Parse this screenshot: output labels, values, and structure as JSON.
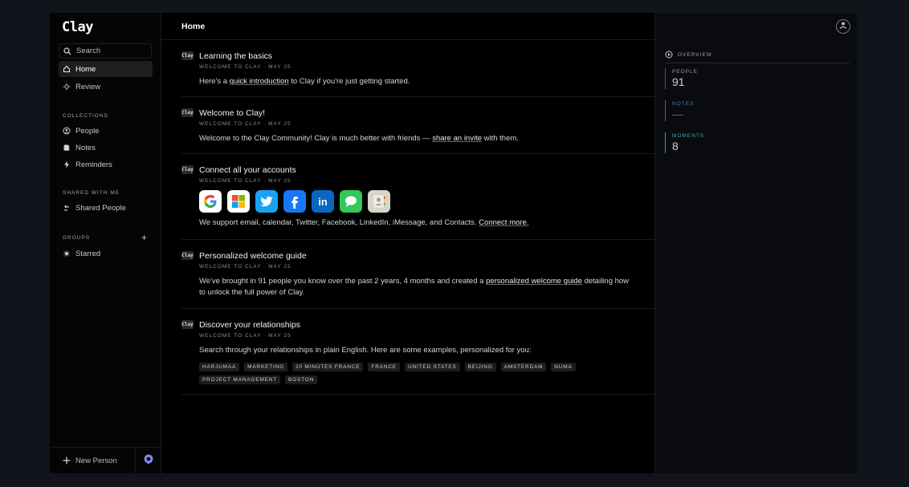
{
  "app": {
    "logo": "Clay"
  },
  "sidebar": {
    "search_label": "Search",
    "nav": [
      {
        "label": "Home",
        "icon": "home-icon",
        "active": true
      },
      {
        "label": "Review",
        "icon": "sun-icon",
        "active": false
      }
    ],
    "collections_label": "COLLECTIONS",
    "collections": [
      {
        "label": "People",
        "icon": "person-circle-icon"
      },
      {
        "label": "Notes",
        "icon": "notes-icon"
      },
      {
        "label": "Reminders",
        "icon": "bolt-icon"
      }
    ],
    "shared_label": "SHARED WITH ME",
    "shared": [
      {
        "label": "Shared People",
        "icon": "shared-people-icon"
      }
    ],
    "groups_label": "GROUPS",
    "groups": [
      {
        "label": "Starred",
        "icon": "star-icon"
      }
    ],
    "new_person_label": "New Person"
  },
  "main": {
    "title": "Home",
    "badge": "Clay",
    "cards": [
      {
        "title": "Learning the basics",
        "meta": "WELCOME TO CLAY · MAY 25",
        "body_pre": "Here's a ",
        "link": "quick introduction",
        "body_post": " to Clay if you're just getting started."
      },
      {
        "title": "Welcome to Clay!",
        "meta": "WELCOME TO CLAY · MAY 25",
        "body_pre": "Welcome to the Clay Community! Clay is much better with friends — ",
        "link": "share an invite",
        "body_post": " with them."
      },
      {
        "title": "Connect all your accounts",
        "meta": "WELCOME TO CLAY · MAY 25",
        "body_pre": "We support email, calendar, Twitter, Facebook, LinkedIn, iMessage, and Contacts. ",
        "link": "Connect more.",
        "body_post": "",
        "apps": [
          {
            "name": "google-icon",
            "glyph": "G",
            "bg": "#ffffff",
            "fg": "#4285f4"
          },
          {
            "name": "microsoft-icon",
            "glyph": "",
            "bg": "#ffffff",
            "fg": "#000000"
          },
          {
            "name": "twitter-icon",
            "glyph": "t",
            "bg": "#1da1f2",
            "fg": "#ffffff"
          },
          {
            "name": "facebook-icon",
            "glyph": "f",
            "bg": "#1877f2",
            "fg": "#ffffff"
          },
          {
            "name": "linkedin-icon",
            "glyph": "in",
            "bg": "#0a66c2",
            "fg": "#ffffff"
          },
          {
            "name": "imessage-icon",
            "glyph": "",
            "bg": "#34c759",
            "fg": "#ffffff"
          },
          {
            "name": "contacts-icon",
            "glyph": "",
            "bg": "#d9d4c9",
            "fg": "#8a8a8a"
          }
        ]
      },
      {
        "title": "Personalized welcome guide",
        "meta": "WELCOME TO CLAY · MAY 25",
        "body_pre": "We've brought in 91 people you know over the past 2 years, 4 months and created a ",
        "link": "personalized welcome guide",
        "body_post": " detailing how to unlock the full power of Clay."
      },
      {
        "title": "Discover your relationships",
        "meta": "WELCOME TO CLAY · MAY 25",
        "body_pre": "Search through your relationships in plain English. Here are some examples, personalized for you:",
        "link": "",
        "body_post": "",
        "tags": [
          "HARJUMAA",
          "MARKETING",
          "20 MINUTES FRANCE",
          "FRANCE",
          "UNITED STATES",
          "BEIJING",
          "AMSTERDAM",
          "NUMA",
          "PROJECT MANAGEMENT",
          "BOSTON"
        ]
      }
    ]
  },
  "right": {
    "overview_label": "OVERVIEW",
    "stats": [
      {
        "label": "PEOPLE",
        "value": "91",
        "color": "#555555"
      },
      {
        "label": "NOTES",
        "value": "—",
        "color": "#2f6fa3"
      },
      {
        "label": "MOMENTS",
        "value": "8",
        "color": "#2aa3a3"
      }
    ]
  }
}
